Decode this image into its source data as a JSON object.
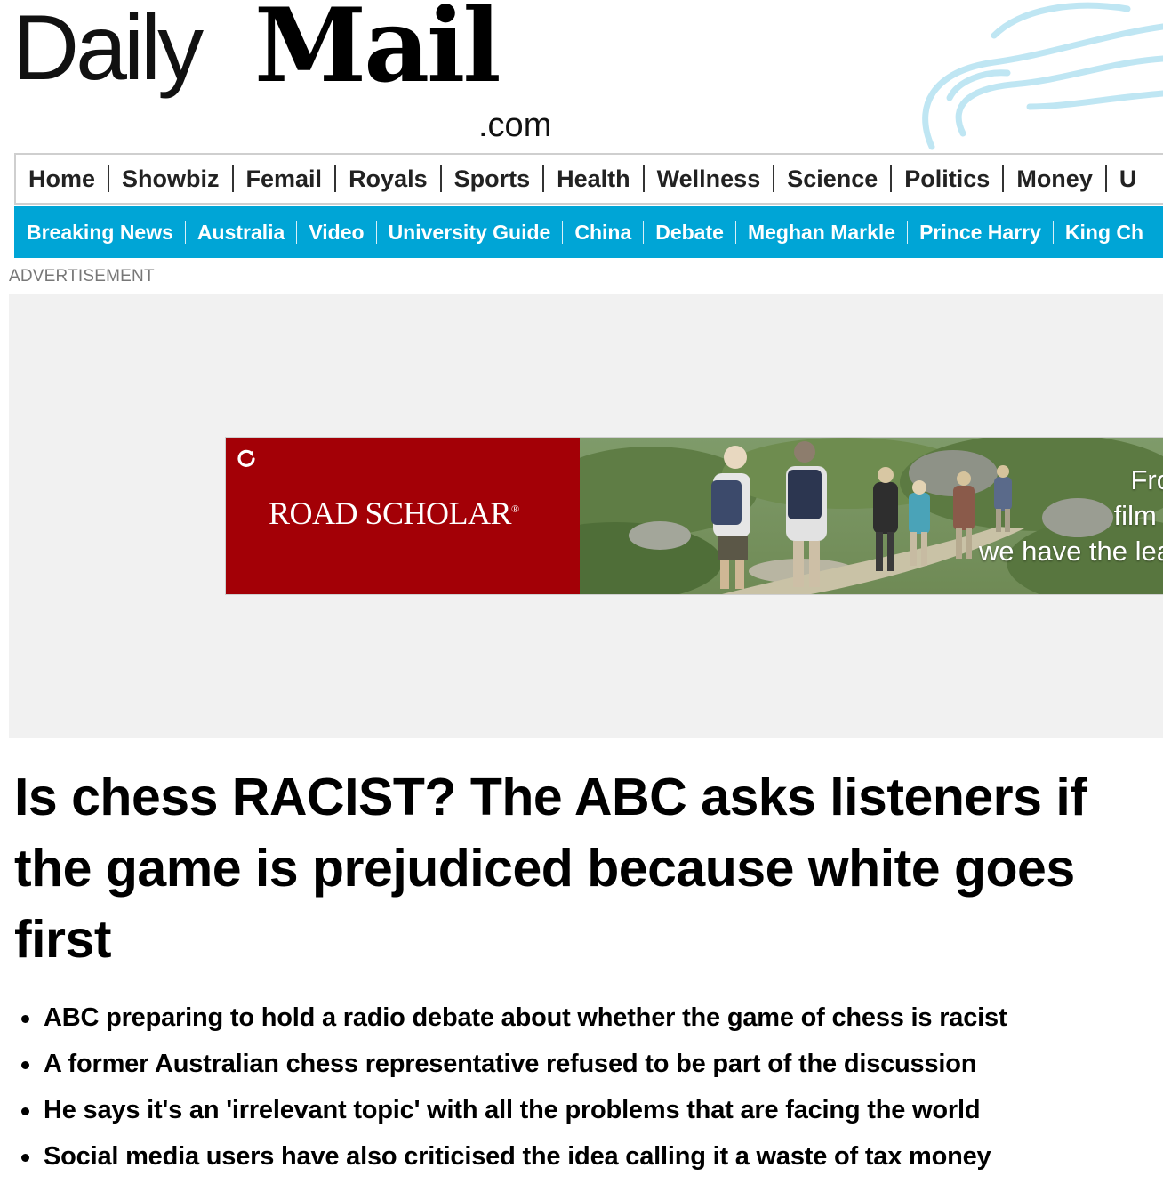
{
  "site": {
    "logo_daily": "Daily",
    "logo_mail": "Mail",
    "logo_com": ".com"
  },
  "nav_primary": [
    "Home",
    "Showbiz",
    "Femail",
    "Royals",
    "Sports",
    "Health",
    "Wellness",
    "Science",
    "Politics",
    "Money",
    "U"
  ],
  "nav_secondary": [
    "Breaking News",
    "Australia",
    "Video",
    "University Guide",
    "China",
    "Debate",
    "Meghan Markle",
    "Prince Harry",
    "King Ch"
  ],
  "ad": {
    "label": "ADVERTISEMENT",
    "brand": "ROAD SCHOLAR",
    "trademark": "®",
    "text_line1": "Fro",
    "text_line2": "film f",
    "text_line3": "we have the lea",
    "colors": {
      "brand_red": "#a30006",
      "nav_blue": "#00a5d6"
    }
  },
  "article": {
    "headline": "Is chess RACIST? The ABC asks listeners if the game is prejudiced because white goes first",
    "bullets": [
      "ABC preparing to hold a radio debate about whether the game of chess is racist",
      "A former Australian chess representative refused to be part of the discussion",
      "He says it's an 'irrelevant topic' with all the problems that are facing the world",
      "Social media users have also criticised the idea calling it a waste of tax money"
    ]
  }
}
